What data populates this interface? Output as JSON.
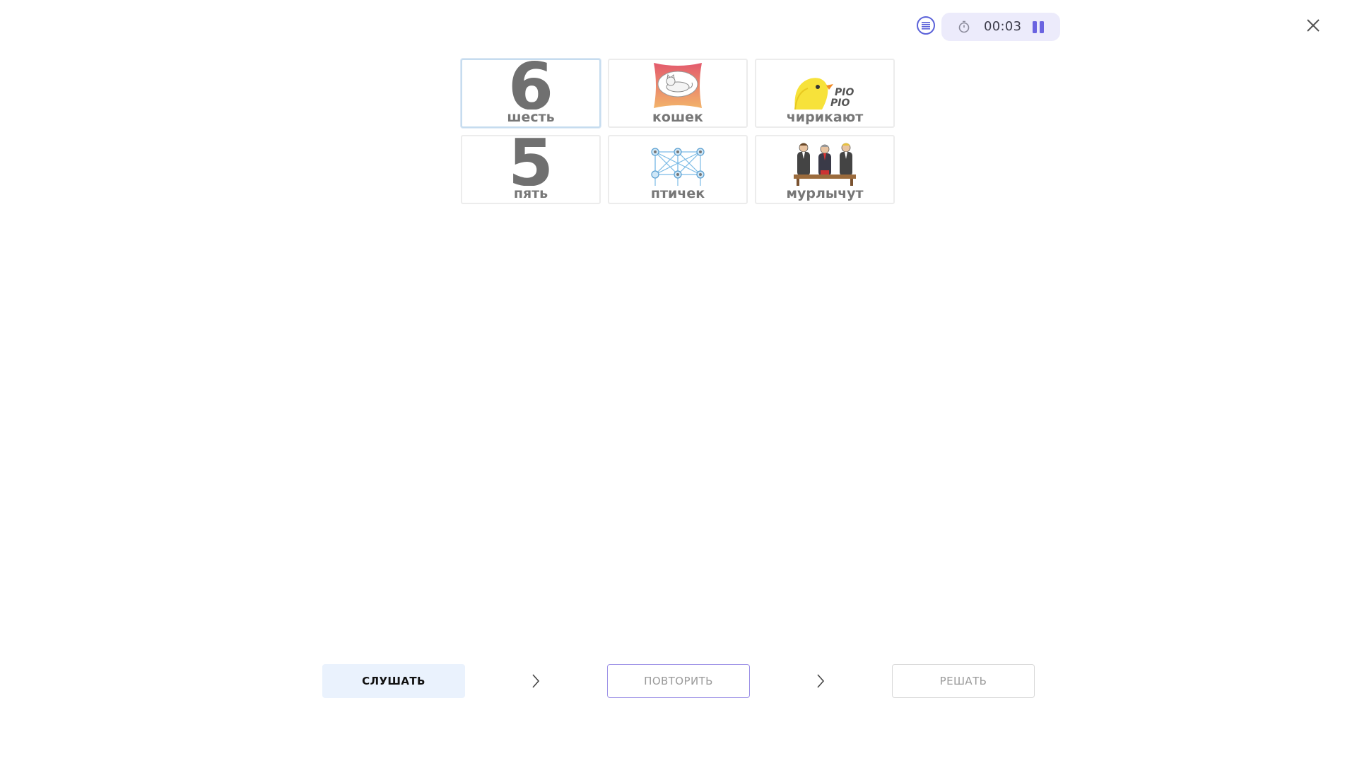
{
  "timer": {
    "time": "00:03"
  },
  "cards": [
    {
      "label": "шесть",
      "digit": "6"
    },
    {
      "label": "кошек"
    },
    {
      "label": "чирикают",
      "pio1": "PIO",
      "pio2": "PIO"
    },
    {
      "label": "пять",
      "digit": "5"
    },
    {
      "label": "птичек"
    },
    {
      "label": "мурлычут"
    }
  ],
  "buttons": {
    "listen": "СЛУШАТЬ",
    "repeat": "ПОВТОРИТЬ",
    "solve": "РЕШАТЬ"
  },
  "colors": {
    "accent": "#5b62d9",
    "timer_bg": "#ecebfb",
    "listen_bg": "#eaf2fd",
    "selected_border": "#c6dcef"
  },
  "icons": [
    "list-icon",
    "timer-icon",
    "pause-icon",
    "close-icon",
    "chevron-right-icon"
  ]
}
